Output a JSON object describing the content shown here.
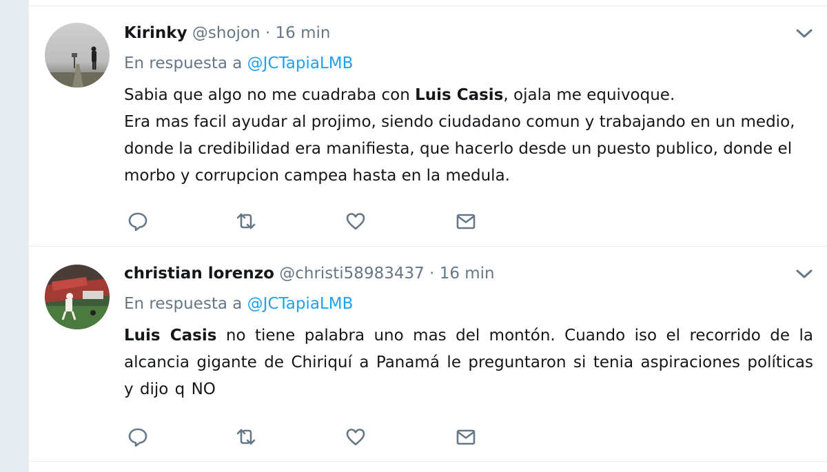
{
  "tweets": [
    {
      "fullname": "Kirinky",
      "username": "@shojon",
      "separator": " · ",
      "time": "16 min",
      "reply_prefix": "En respuesta a ",
      "reply_to": "@JCTapiaLMB",
      "text_parts": [
        "Sabia que algo no me cuadraba con ",
        "Luis Casis",
        ", ojala me equivoque.",
        "Era mas facil ayudar al projimo, siendo ciudadano comun y trabajando en un medio, donde la credibilidad era manifiesta, que hacerlo desde un puesto publico, donde el morbo y corrupcion campea hasta en la medula."
      ]
    },
    {
      "fullname": "christian lorenzo",
      "username": "@christi58983437",
      "separator": " · ",
      "time": "16 min",
      "reply_prefix": "En respuesta a ",
      "reply_to": "@JCTapiaLMB",
      "text_parts": [
        "Luis  Casis",
        " no  tiene  palabra uno mas  del montón.  Cuando  iso  el  recorrido de la  alcancia  gigante de Chiriquí a Panamá le preguntaron  si tenia aspiraciones políticas y  dijo  q  NO"
      ]
    }
  ],
  "actions": [
    "reply-icon",
    "retweet-icon",
    "like-icon",
    "direct-message-icon"
  ],
  "colors": {
    "background": "#e6ecf0",
    "text": "#14171a",
    "secondary": "#657786",
    "mention": "#1da1f2"
  }
}
